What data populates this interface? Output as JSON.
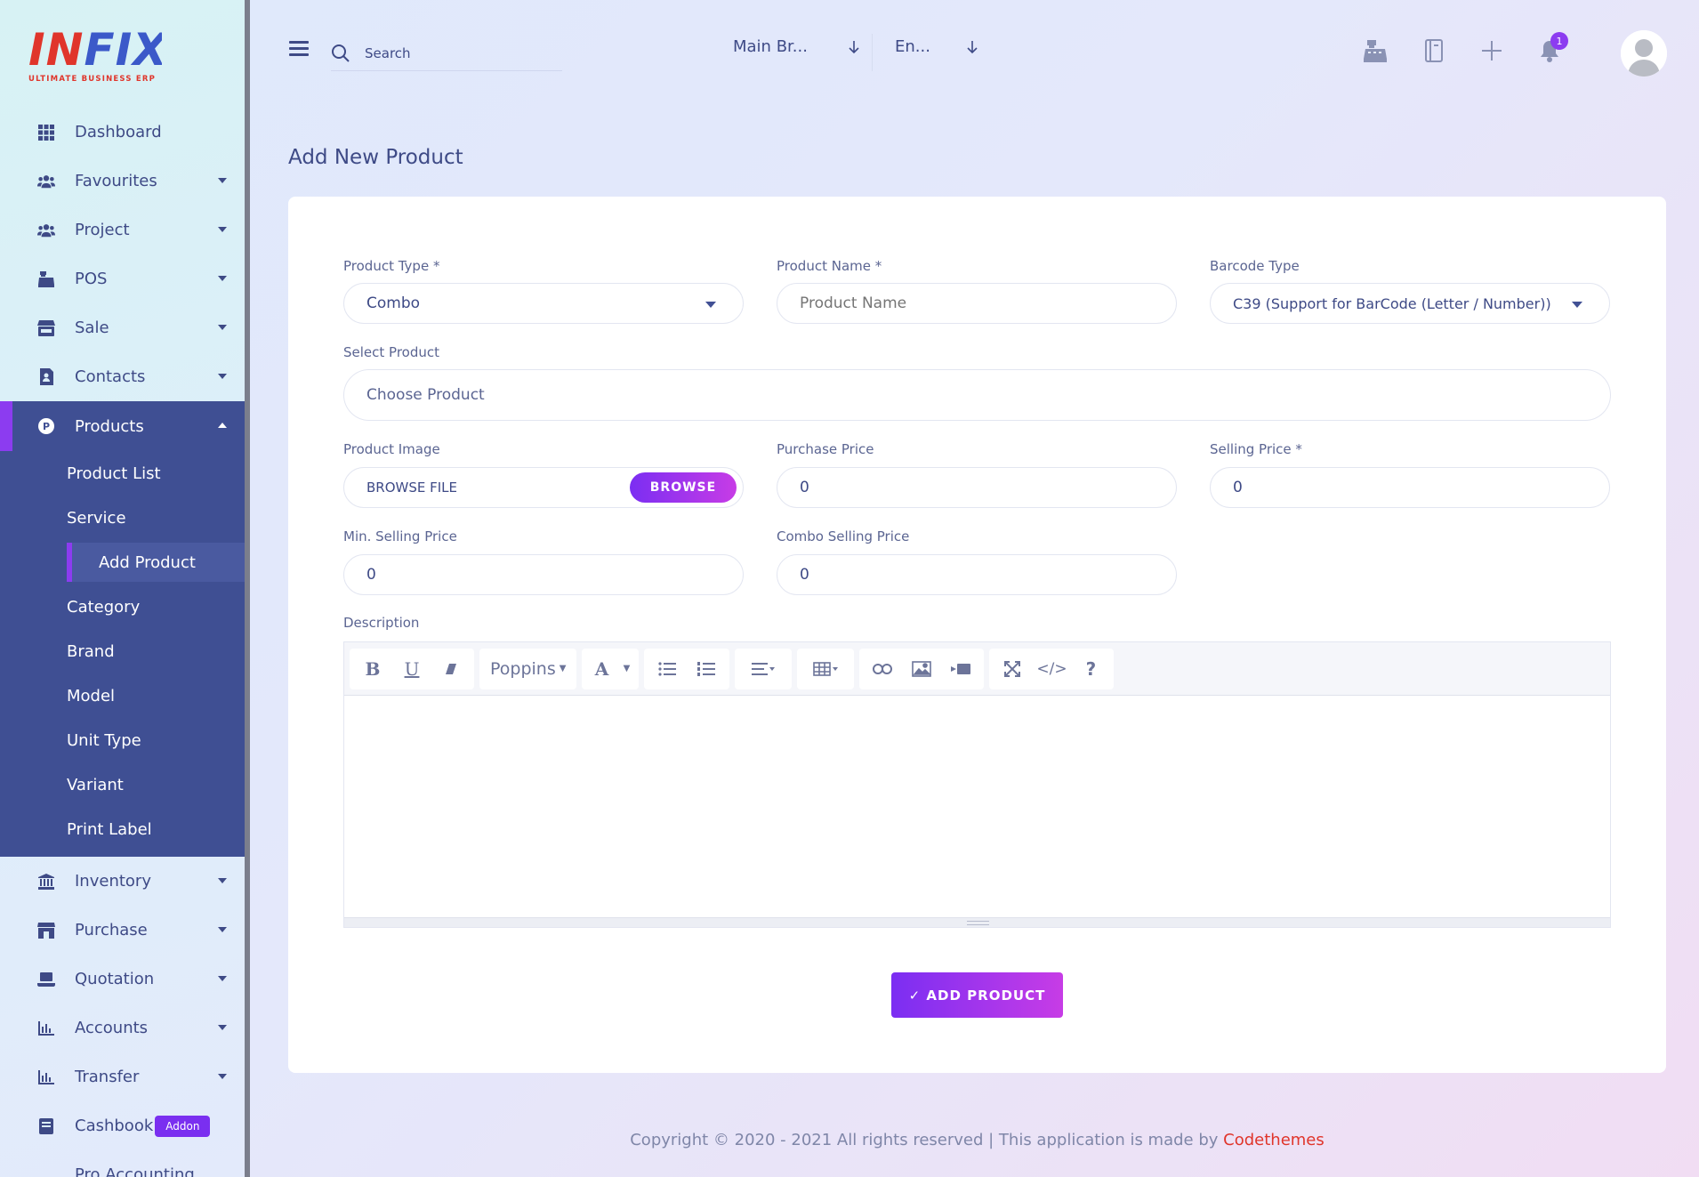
{
  "app": {
    "logo_main": "INFIX",
    "logo_sub": "ULTIMATE BUSINESS ERP"
  },
  "sidebar": {
    "items": [
      {
        "label": "Dashboard",
        "icon": "grid-icon"
      },
      {
        "label": "Favourites",
        "icon": "users-icon"
      },
      {
        "label": "Project",
        "icon": "users-icon"
      },
      {
        "label": "POS",
        "icon": "cash-register-icon"
      },
      {
        "label": "Sale",
        "icon": "store-icon"
      },
      {
        "label": "Contacts",
        "icon": "contact-book-icon"
      },
      {
        "label": "Products",
        "icon": "product-p-icon"
      },
      {
        "label": "Inventory",
        "icon": "bank-icon"
      },
      {
        "label": "Purchase",
        "icon": "shop-icon"
      },
      {
        "label": "Quotation",
        "icon": "laptop-icon"
      },
      {
        "label": "Accounts",
        "icon": "bar-chart-icon"
      },
      {
        "label": "Transfer",
        "icon": "bar-chart-icon"
      },
      {
        "label": "Cashbook",
        "icon": "book-icon",
        "badge": "Addon"
      },
      {
        "label": "Pro Accounting"
      }
    ],
    "products_submenu": [
      "Product List",
      "Service",
      "Add Product",
      "Category",
      "Brand",
      "Model",
      "Unit Type",
      "Variant",
      "Print Label"
    ]
  },
  "header": {
    "search_placeholder": "Search",
    "branch": "Main Br...",
    "language": "En...",
    "notification_count": "1"
  },
  "page": {
    "title": "Add New Product"
  },
  "form": {
    "product_type": {
      "label": "Product Type *",
      "value": "Combo"
    },
    "product_name": {
      "label": "Product Name *",
      "placeholder": "Product Name"
    },
    "barcode_type": {
      "label": "Barcode Type",
      "value": "C39 (Support for BarCode (Letter / Number))"
    },
    "select_product": {
      "label": "Select Product",
      "placeholder": "Choose Product"
    },
    "product_image": {
      "label": "Product Image",
      "value": "BROWSE FILE",
      "button": "BROWSE"
    },
    "purchase_price": {
      "label": "Purchase Price",
      "value": "0"
    },
    "selling_price": {
      "label": "Selling Price *",
      "value": "0"
    },
    "min_selling_price": {
      "label": "Min. Selling Price",
      "value": "0"
    },
    "combo_selling_price": {
      "label": "Combo Selling Price",
      "value": "0"
    },
    "description": {
      "label": "Description",
      "font_name": "Poppins"
    },
    "submit": "✓ ADD PRODUCT"
  },
  "footer": {
    "text": "Copyright © 2020 - 2021 All rights reserved | This application is made by ",
    "brand": "Codethemes"
  },
  "colors": {
    "accent": "#8c3cf0",
    "sidebar_active": "#3f4f93",
    "text": "#415094",
    "brand_red": "#e0352b"
  }
}
